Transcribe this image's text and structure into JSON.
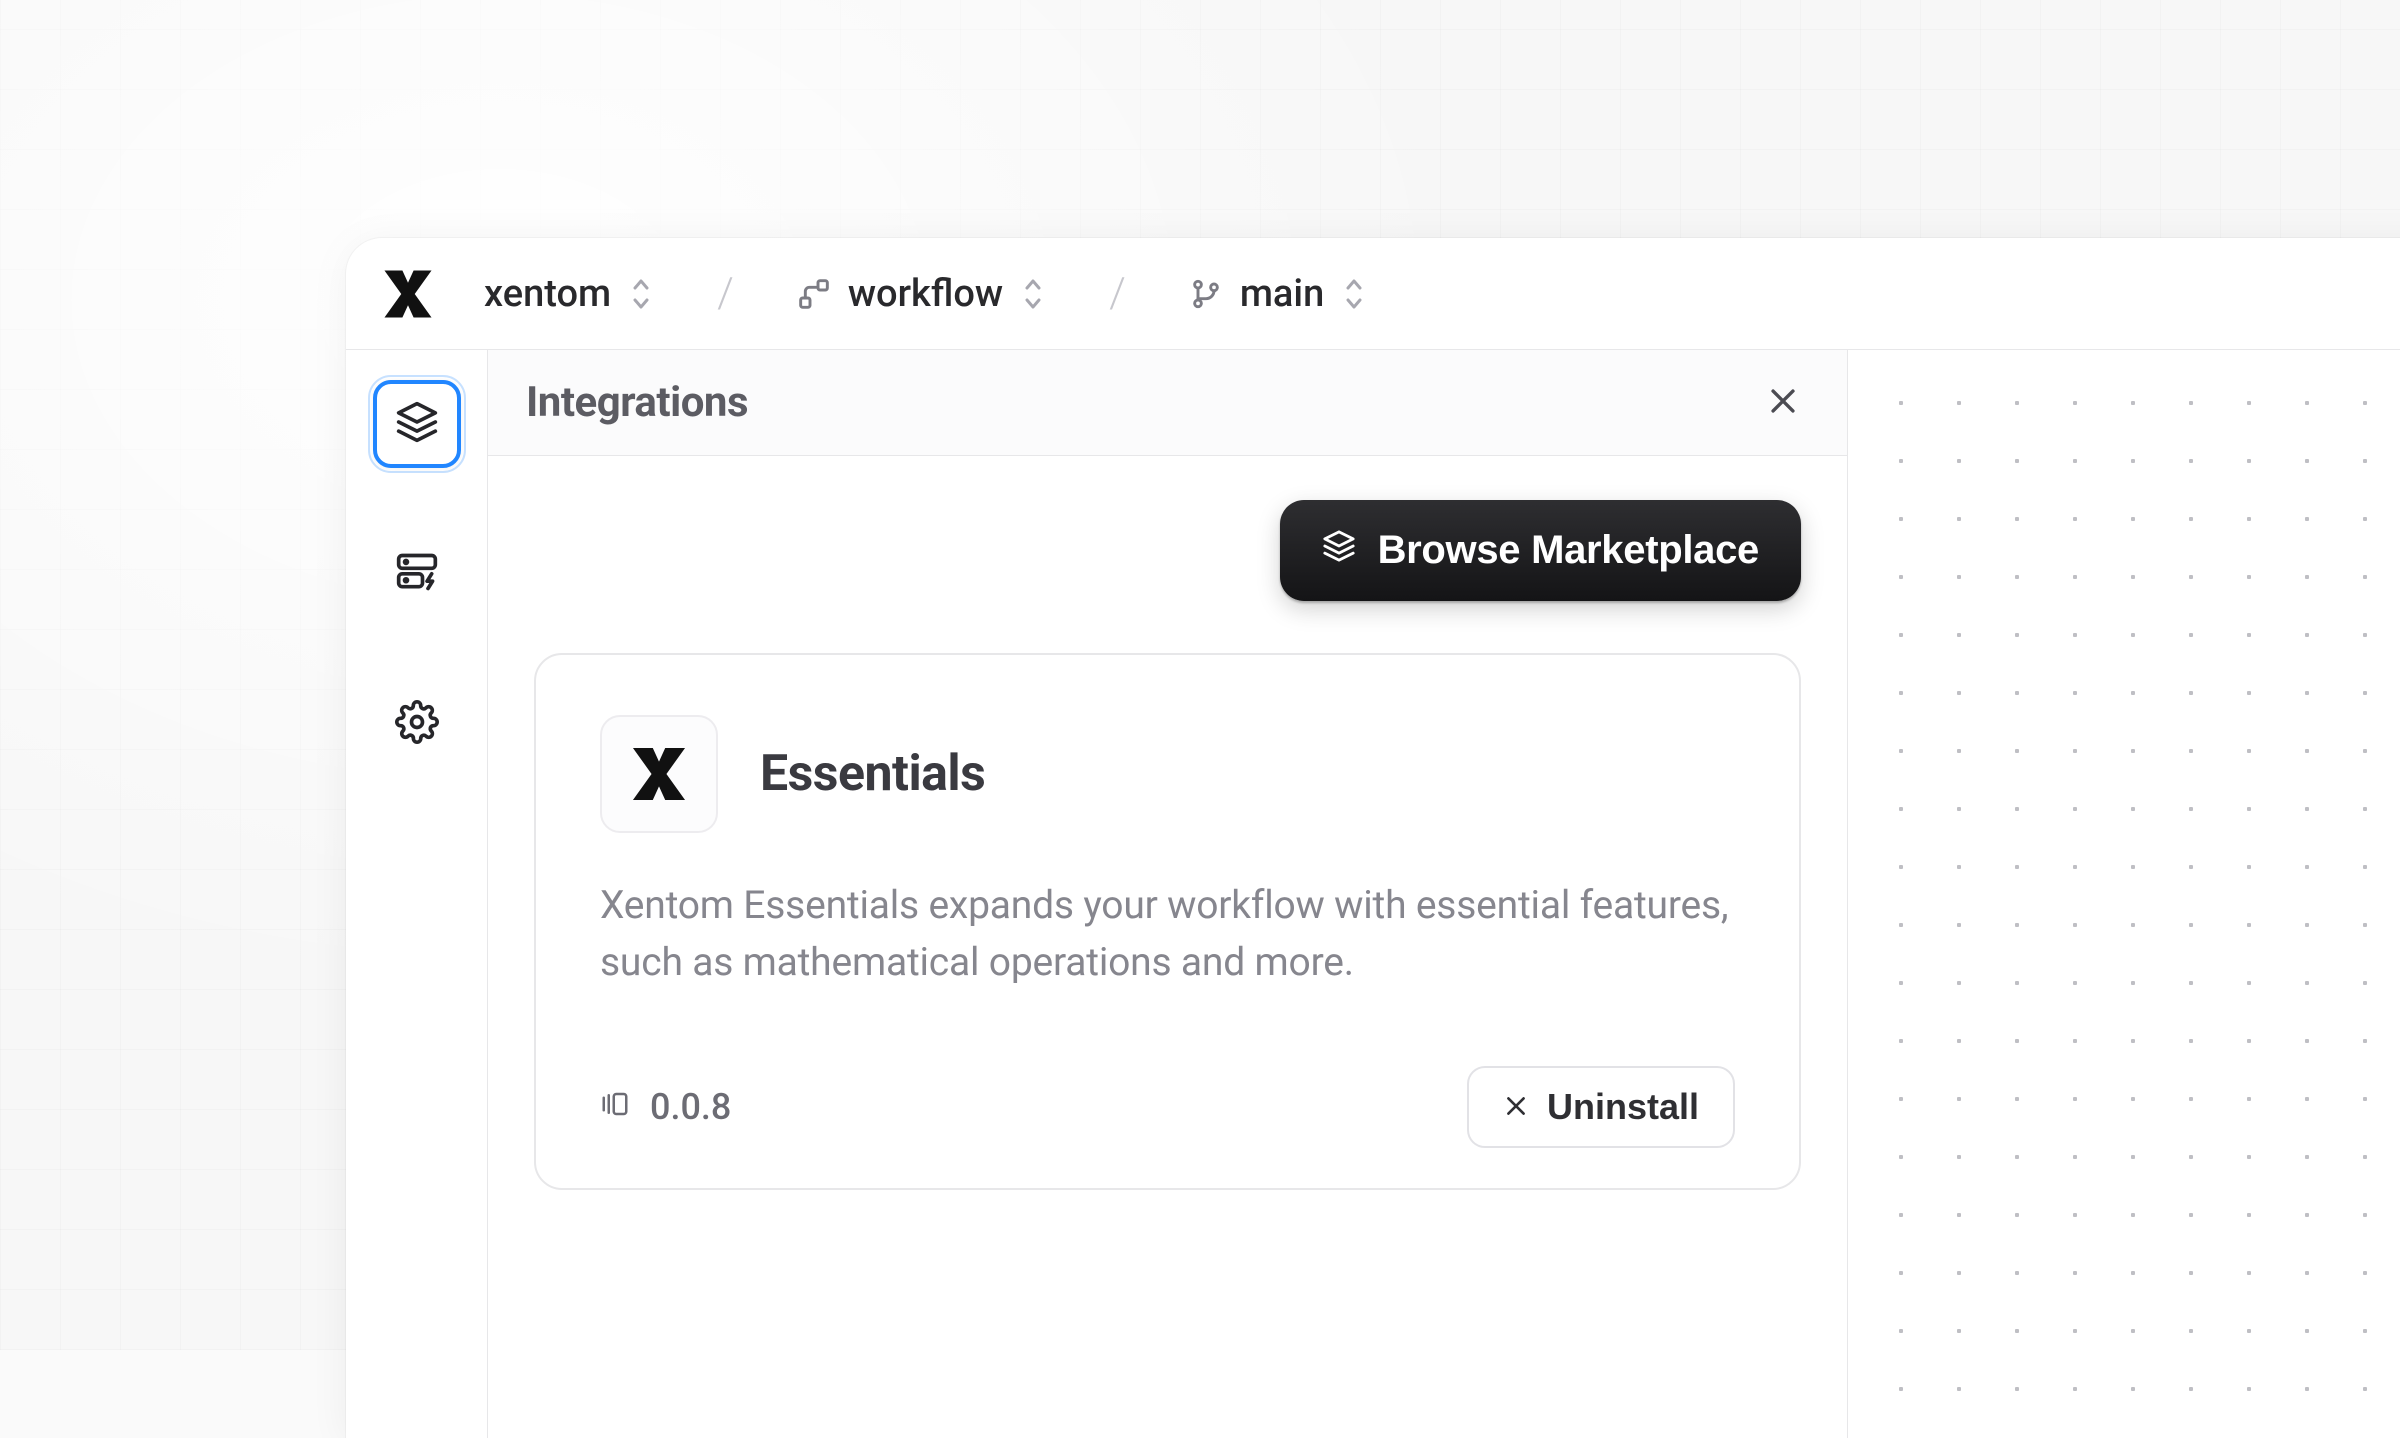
{
  "breadcrumb": {
    "org": {
      "label": "xentom"
    },
    "project": {
      "label": "workflow"
    },
    "branch": {
      "label": "main"
    }
  },
  "panel": {
    "title": "Integrations",
    "browse_label": "Browse Marketplace"
  },
  "integration": {
    "name": "Essentials",
    "description": "Xentom Essentials expands your workflow with essential features, such as mathematical operations and more.",
    "version": "0.0.8",
    "uninstall_label": "Uninstall"
  }
}
